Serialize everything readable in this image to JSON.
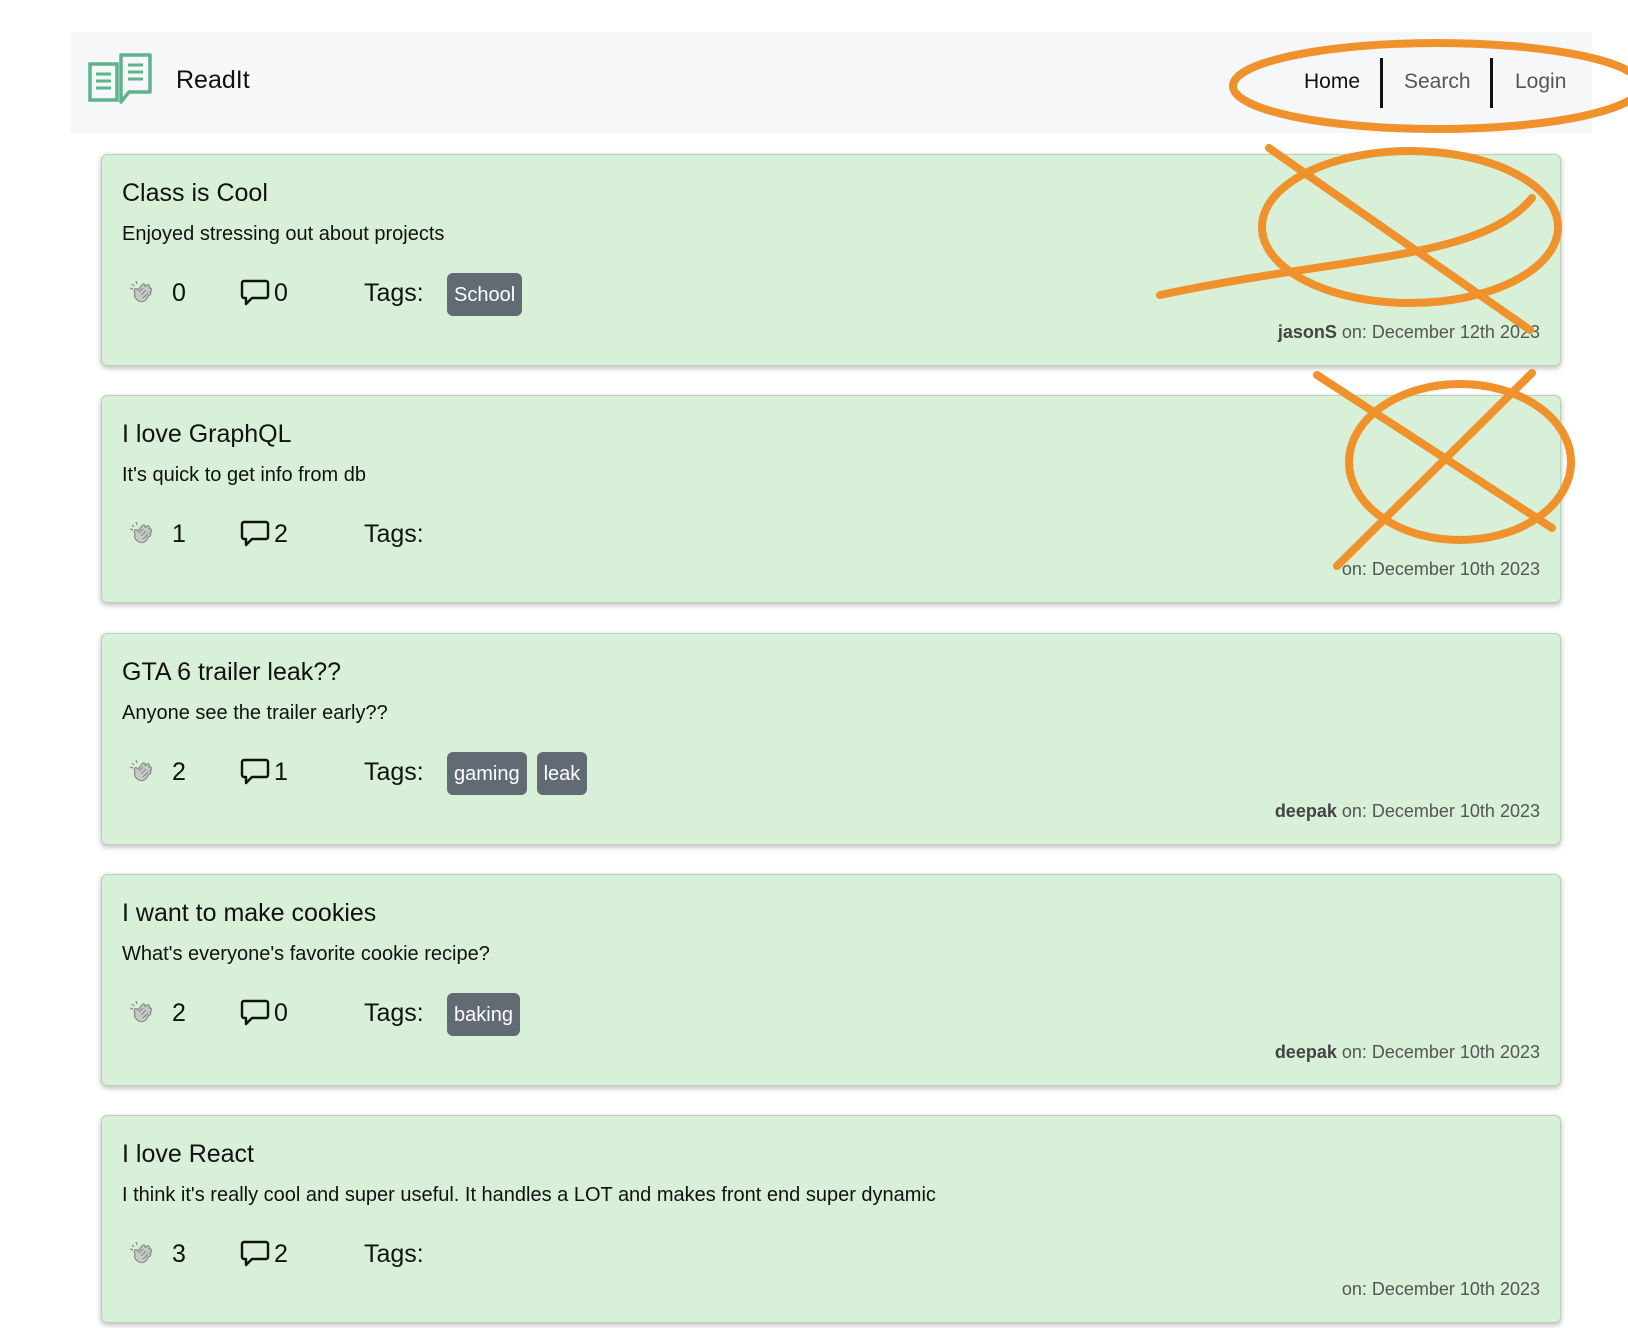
{
  "app": {
    "name": "ReadIt"
  },
  "nav": {
    "items": [
      {
        "label": "Home",
        "active": true
      },
      {
        "label": "Search",
        "active": false
      },
      {
        "label": "Login",
        "active": false
      }
    ]
  },
  "labels": {
    "tags": "Tags:",
    "on_prefix": "on: "
  },
  "posts": [
    {
      "title": "Class is Cool",
      "body": "Enjoyed stressing out about projects",
      "claps": "0",
      "comments": "0",
      "tags": [
        "School"
      ],
      "author": "jasonS",
      "date": "December 12th 2023"
    },
    {
      "title": "I love GraphQL",
      "body": "It's quick to get info from db",
      "claps": "1",
      "comments": "2",
      "tags": [],
      "author": "",
      "date": "December 10th 2023"
    },
    {
      "title": "GTA 6 trailer leak??",
      "body": "Anyone see the trailer early??",
      "claps": "2",
      "comments": "1",
      "tags": [
        "gaming",
        "leak"
      ],
      "author": "deepak",
      "date": "December 10th 2023"
    },
    {
      "title": "I want to make cookies",
      "body": "What's everyone's favorite cookie recipe?",
      "claps": "2",
      "comments": "0",
      "tags": [
        "baking"
      ],
      "author": "deepak",
      "date": "December 10th 2023"
    },
    {
      "title": "I love React",
      "body": "I think it's really cool and super useful. It handles a LOT and makes front end super dynamic",
      "claps": "3",
      "comments": "2",
      "tags": [],
      "author": "",
      "date": "December 10th 2023"
    }
  ],
  "colors": {
    "card_background": "#d7f0d7",
    "tag_background": "#626a73",
    "navbar_background": "#f6f7f8",
    "logo_green": "#5fb38a",
    "annotation_orange": "#f0922b"
  },
  "icons": {
    "brand": "open-book-icon",
    "clap": "clapping-hands-icon",
    "comment": "speech-bubble-icon"
  }
}
